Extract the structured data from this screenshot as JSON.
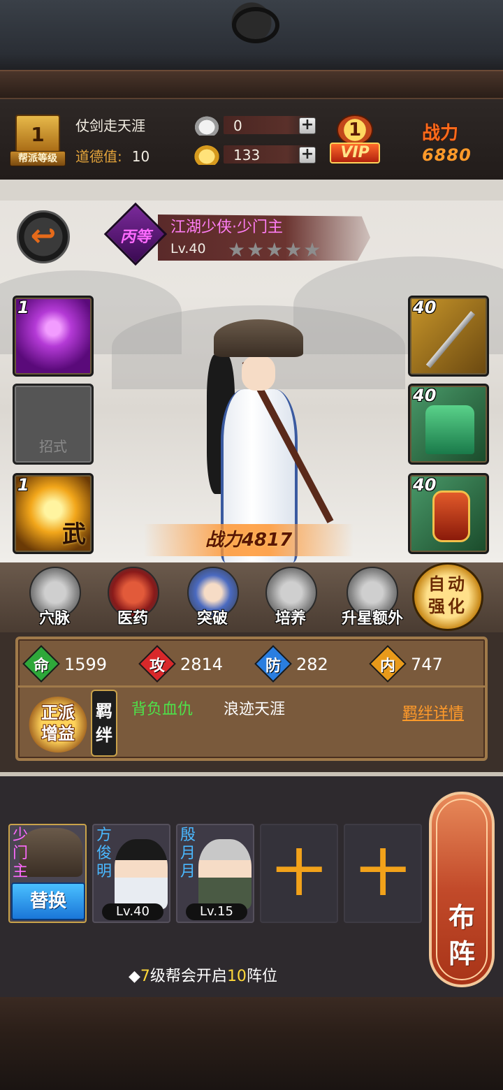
{
  "status": {
    "guild_level": "1",
    "guild_label": "帮派等级",
    "player_name": "仗剑走天涯",
    "morality_label": "道德值:",
    "morality_value": "10",
    "silver": "0",
    "gold": "133",
    "vip_level": "1",
    "vip_label": "VIP",
    "power_label": "战力",
    "power_value": "6880"
  },
  "character": {
    "rank": "丙等",
    "title": "江湖少侠·少门主",
    "level": "Lv.40",
    "stars_filled": 0,
    "stars_total": 5,
    "stars_text": "★★★★★",
    "power_text": "战力4817"
  },
  "slots": {
    "skill1_level": "1",
    "empty_label": "招式",
    "skill2_level": "1",
    "skill2_glyph": "武",
    "weapon_level": "40",
    "armor_level": "40",
    "token_level": "40"
  },
  "actions": {
    "meridian": "穴脉",
    "medicine": "医药",
    "breakthrough": "突破",
    "cultivate": "培养",
    "star_extra": "升星额外",
    "auto_line1": "自动",
    "auto_line2": "强化"
  },
  "stats": {
    "hp_char": "命",
    "hp": "1599",
    "atk_char": "攻",
    "atk": "2814",
    "def_char": "防",
    "def": "282",
    "inner_char": "内",
    "inner": "747",
    "faction_line1": "正派",
    "faction_line2": "增益",
    "bond_line1": "羁",
    "bond_line2": "绊",
    "bond1": "背负血仇",
    "bond2": "浪迹天涯",
    "bond_detail": "羁绊详情"
  },
  "lineup": {
    "members": [
      {
        "name": "少门主",
        "action": "替换"
      },
      {
        "name": "方俊明",
        "level": "Lv.40"
      },
      {
        "name": "殷月月",
        "level": "Lv.15"
      }
    ],
    "empty_plus": "十",
    "formation_line1": "布",
    "formation_line2": "阵",
    "hint_prefix": "◆",
    "hint_num1": "7",
    "hint_mid": "级帮会开启",
    "hint_num2": "10",
    "hint_suffix": "阵位"
  },
  "colors": {
    "power_orange": "#ff6a1a",
    "hp_green": "#2ea83a",
    "atk_red": "#d8282a",
    "def_blue": "#2a7ee0",
    "inner_orange": "#e89a1a",
    "bond_green": "#4ee24a",
    "title_pink": "#ff7ef5",
    "link_orange": "#ff9a2a",
    "hint_yellow": "#ffd83a"
  }
}
